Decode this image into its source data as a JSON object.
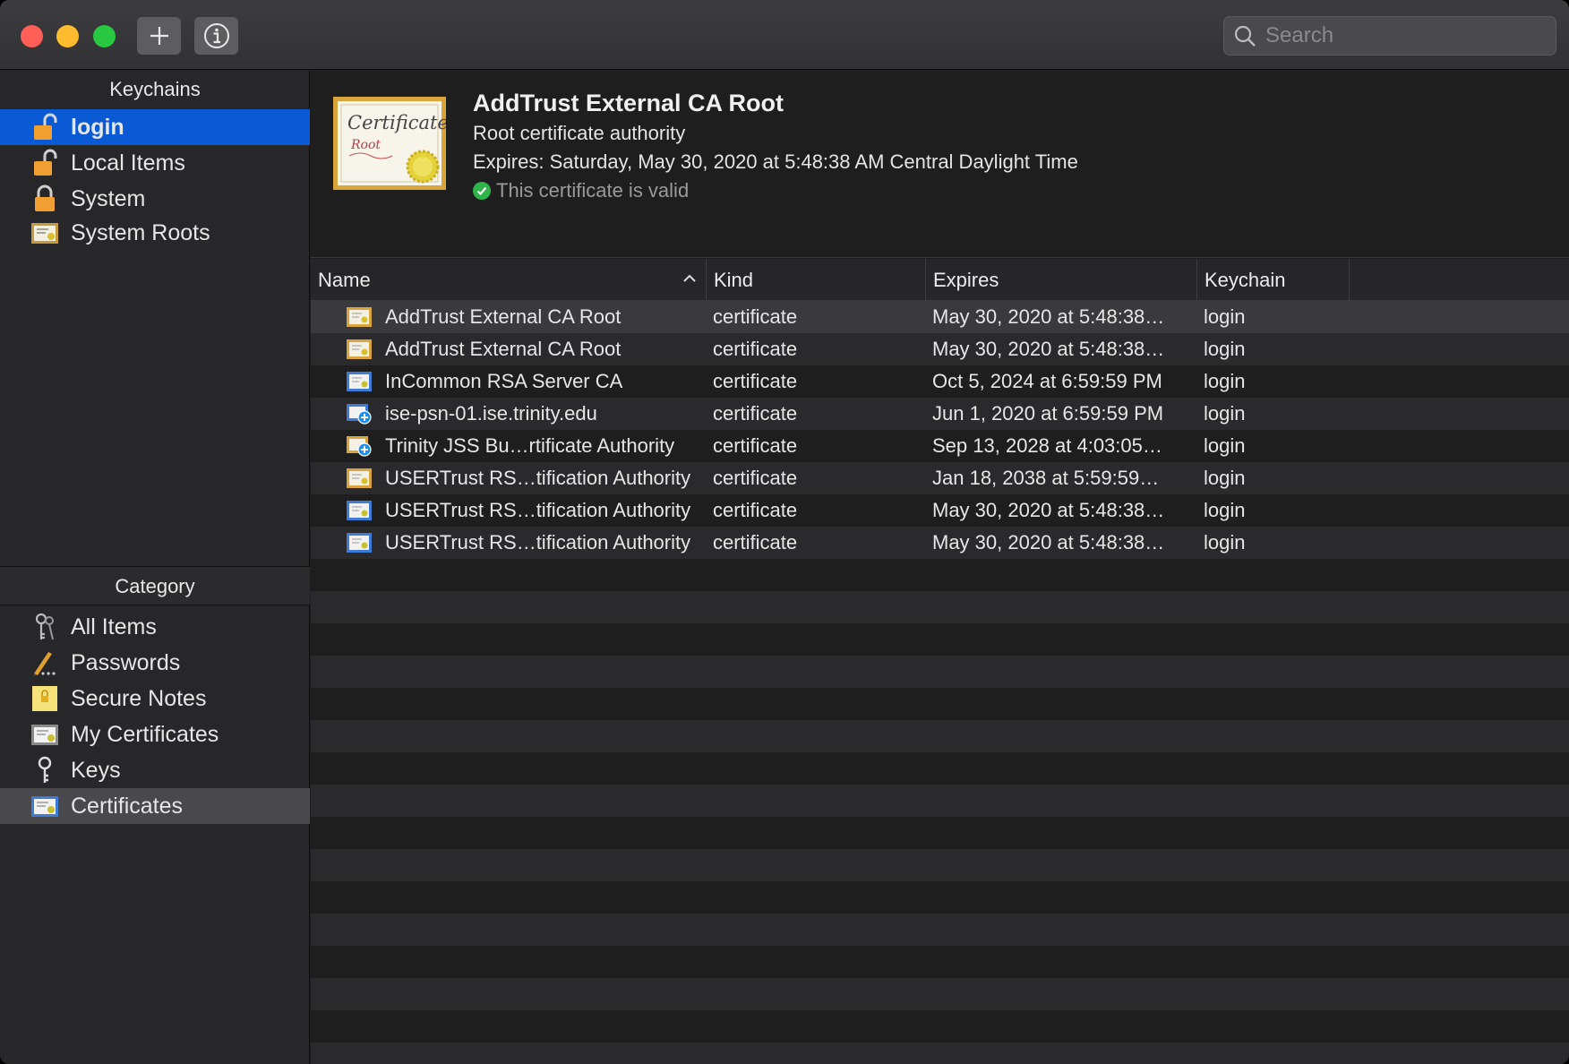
{
  "toolbar": {
    "search_placeholder": "Search"
  },
  "sidebar": {
    "keychains_header": "Keychains",
    "keychains": [
      {
        "label": "login",
        "icon": "unlocked-padlock-icon",
        "selected": true
      },
      {
        "label": "Local Items",
        "icon": "unlocked-padlock-icon"
      },
      {
        "label": "System",
        "icon": "locked-padlock-icon"
      },
      {
        "label": "System Roots",
        "icon": "certificate-cabinet-icon"
      }
    ],
    "category_header": "Category",
    "categories": [
      {
        "label": "All Items",
        "icon": "keys-icon"
      },
      {
        "label": "Passwords",
        "icon": "pencil-icon"
      },
      {
        "label": "Secure Notes",
        "icon": "note-icon"
      },
      {
        "label": "My Certificates",
        "icon": "my-certificate-icon"
      },
      {
        "label": "Keys",
        "icon": "key-icon"
      },
      {
        "label": "Certificates",
        "icon": "certificate-icon",
        "selected": true
      }
    ]
  },
  "detail": {
    "title": "AddTrust External CA Root",
    "subtitle": "Root certificate authority",
    "expires": "Expires: Saturday, May 30, 2020 at 5:48:38 AM Central Daylight Time",
    "status": "This certificate is valid",
    "cert_script_line1": "Certificate",
    "cert_script_line2": "Root"
  },
  "table": {
    "columns": {
      "name": "Name",
      "kind": "Kind",
      "expires": "Expires",
      "keychain": "Keychain"
    },
    "rows": [
      {
        "icon": "root-certificate-icon",
        "name": "AddTrust External CA Root",
        "kind": "certificate",
        "expires": "May 30, 2020 at 5:48:38…",
        "keychain": "login"
      },
      {
        "icon": "root-certificate-icon",
        "name": "AddTrust External CA Root",
        "kind": "certificate",
        "expires": "May 30, 2020 at 5:48:38…",
        "keychain": "login"
      },
      {
        "icon": "intermediate-certificate-icon",
        "name": "InCommon RSA Server CA",
        "kind": "certificate",
        "expires": "Oct 5, 2024 at 6:59:59 PM",
        "keychain": "login"
      },
      {
        "icon": "trusted-certificate-plus-icon",
        "name": "ise-psn-01.ise.trinity.edu",
        "kind": "certificate",
        "expires": "Jun 1, 2020 at 6:59:59 PM",
        "keychain": "login"
      },
      {
        "icon": "trusted-root-certificate-plus-icon",
        "name": "Trinity JSS Bu…rtificate Authority",
        "kind": "certificate",
        "expires": "Sep 13, 2028 at 4:03:05…",
        "keychain": "login"
      },
      {
        "icon": "root-certificate-icon",
        "name": "USERTrust RS…tification Authority",
        "kind": "certificate",
        "expires": "Jan 18, 2038 at 5:59:59…",
        "keychain": "login"
      },
      {
        "icon": "intermediate-certificate-icon",
        "name": "USERTrust RS…tification Authority",
        "kind": "certificate",
        "expires": "May 30, 2020 at 5:48:38…",
        "keychain": "login"
      },
      {
        "icon": "intermediate-certificate-icon",
        "name": "USERTrust RS…tification Authority",
        "kind": "certificate",
        "expires": "May 30, 2020 at 5:48:38…",
        "keychain": "login"
      }
    ]
  }
}
